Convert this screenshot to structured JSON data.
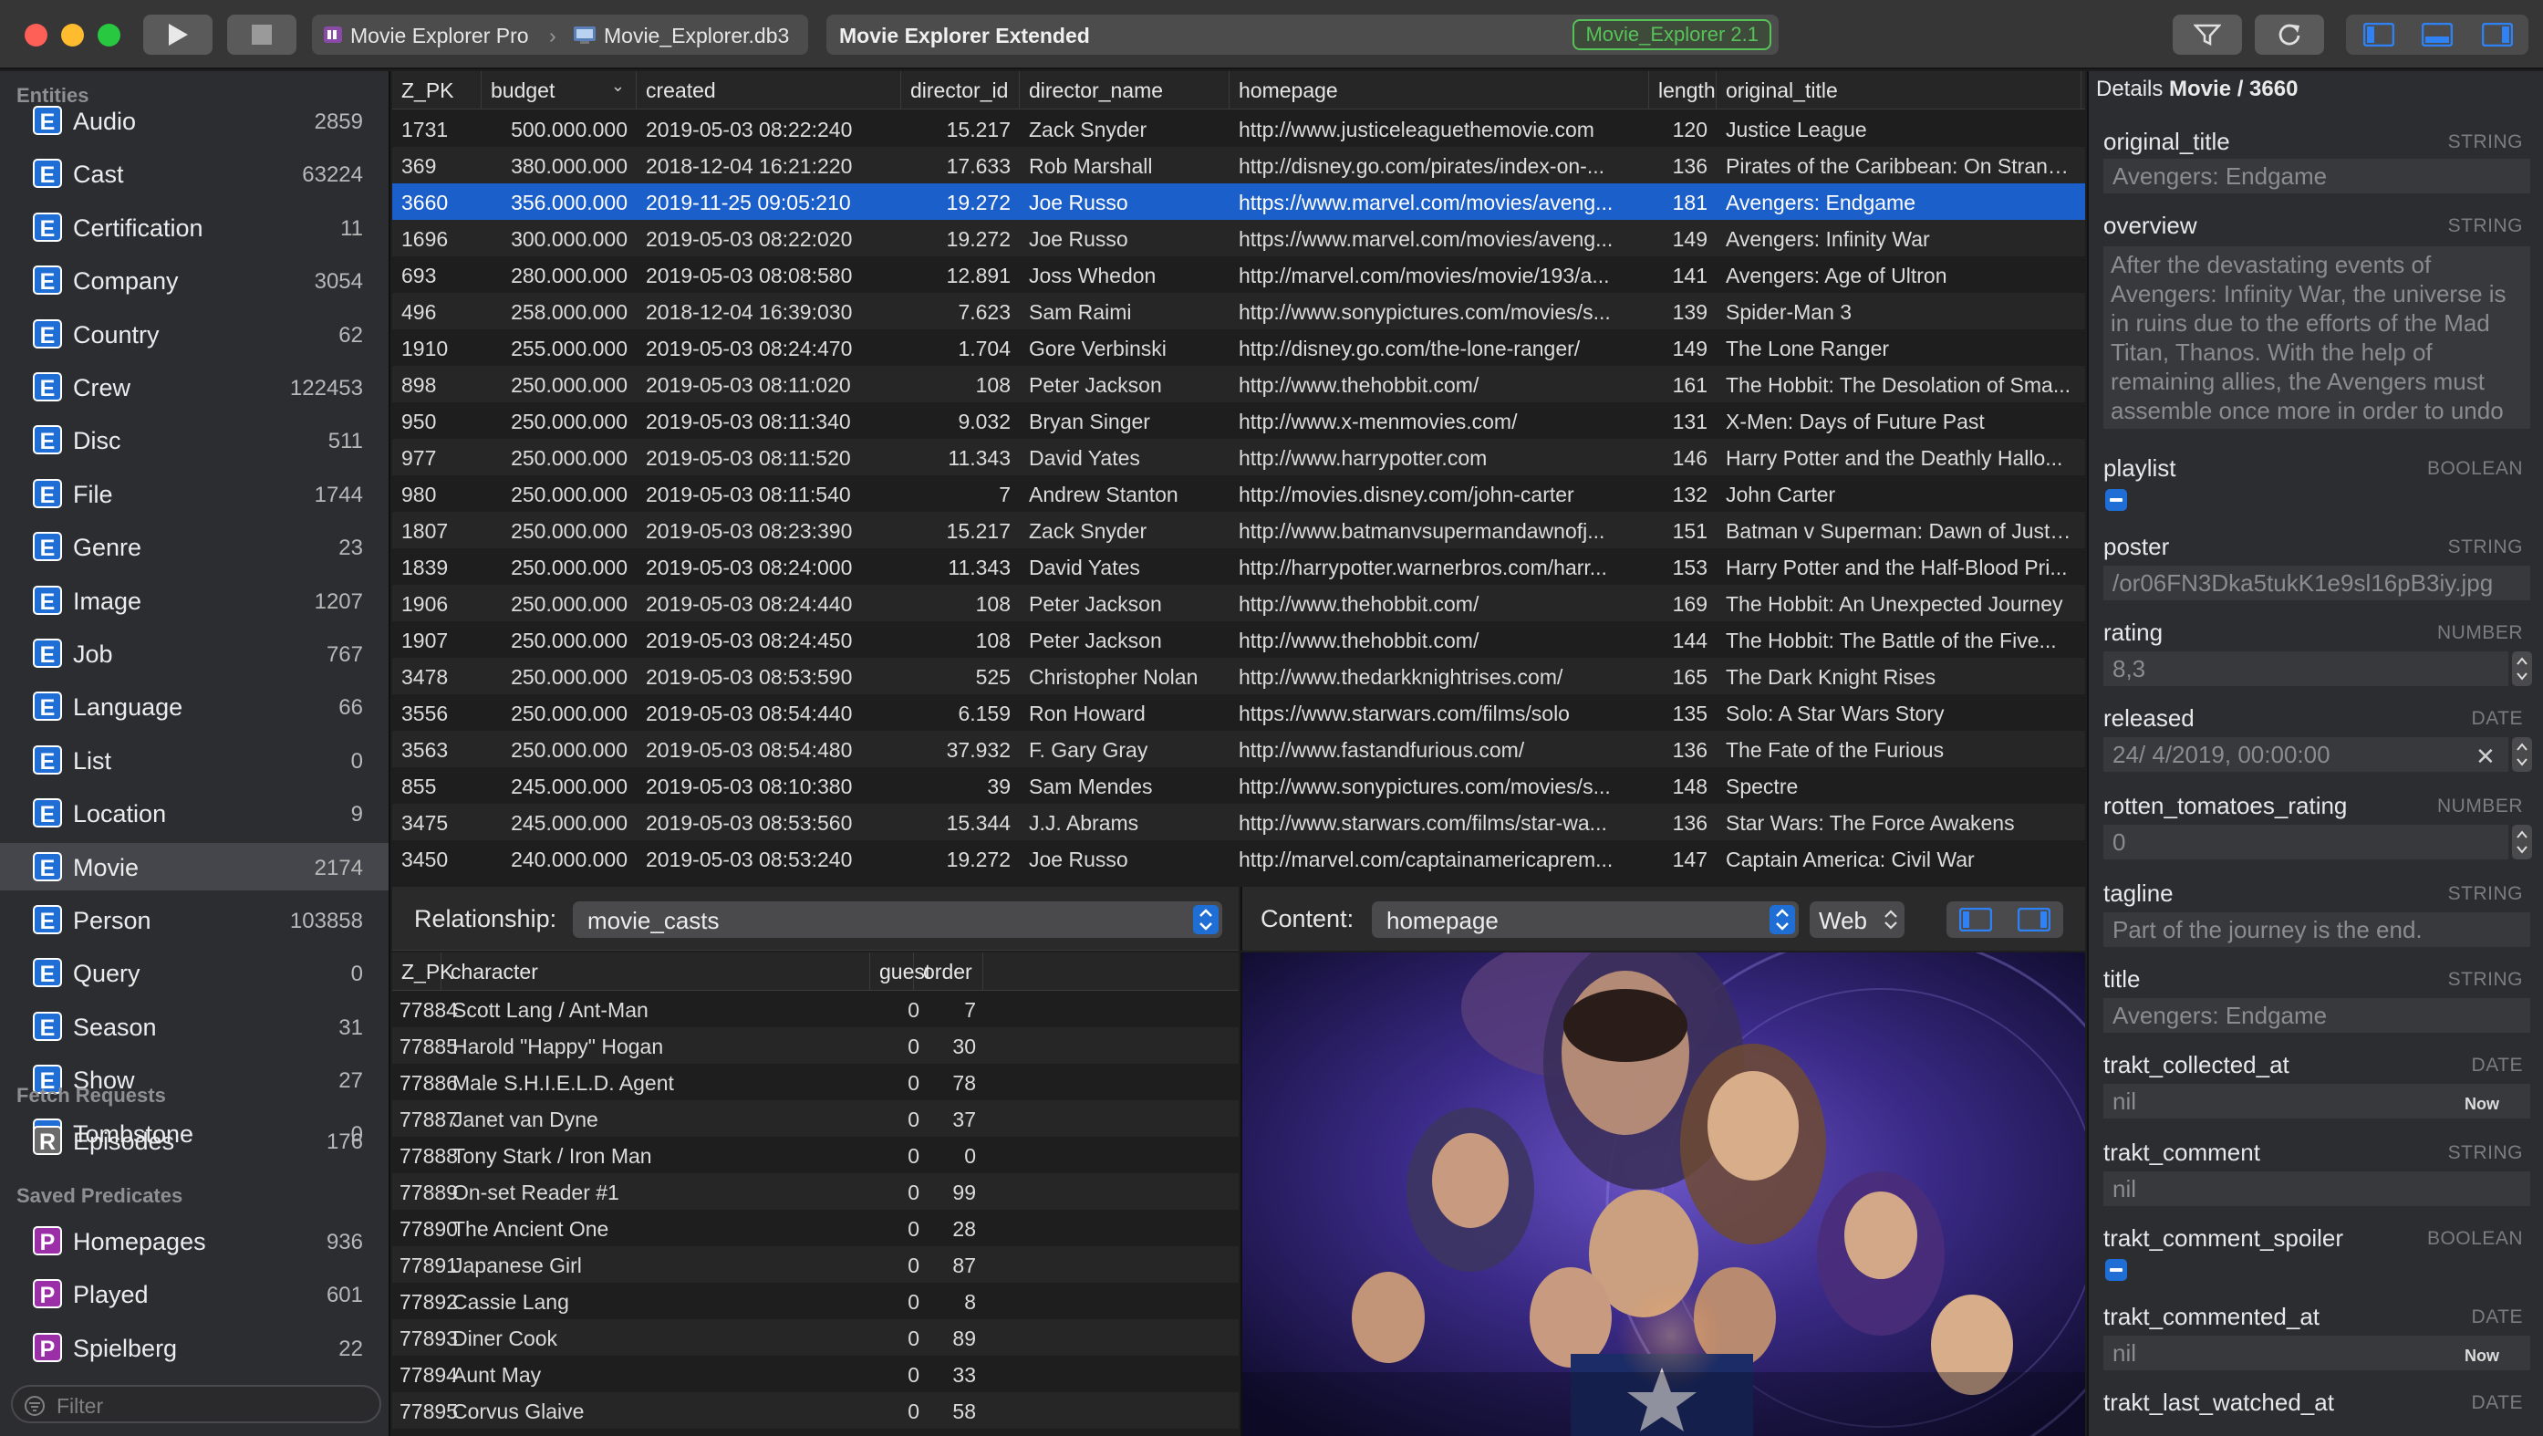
{
  "window": {
    "app_name": "Movie Explorer Pro",
    "file_name": "Movie_Explorer.db3",
    "document_title": "Movie Explorer Extended",
    "version_badge": "Movie_Explorer 2.1"
  },
  "sidebar": {
    "entities_header": "Entities",
    "entities": [
      {
        "label": "Audio",
        "count": "2859"
      },
      {
        "label": "Cast",
        "count": "63224"
      },
      {
        "label": "Certification",
        "count": "11"
      },
      {
        "label": "Company",
        "count": "3054"
      },
      {
        "label": "Country",
        "count": "62"
      },
      {
        "label": "Crew",
        "count": "122453"
      },
      {
        "label": "Disc",
        "count": "511"
      },
      {
        "label": "File",
        "count": "1744"
      },
      {
        "label": "Genre",
        "count": "23"
      },
      {
        "label": "Image",
        "count": "1207"
      },
      {
        "label": "Job",
        "count": "767"
      },
      {
        "label": "Language",
        "count": "66"
      },
      {
        "label": "List",
        "count": "0"
      },
      {
        "label": "Location",
        "count": "9"
      },
      {
        "label": "Movie",
        "count": "2174"
      },
      {
        "label": "Person",
        "count": "103858"
      },
      {
        "label": "Query",
        "count": "0"
      },
      {
        "label": "Season",
        "count": "31"
      },
      {
        "label": "Show",
        "count": "27"
      },
      {
        "label": "Tombstone",
        "count": "0"
      }
    ],
    "entity_badge": "E",
    "fetch_header": "Fetch Requests",
    "fetch_requests": [
      {
        "label": "Episodes",
        "count": "176"
      }
    ],
    "fetch_badge": "R",
    "predicates_header": "Saved Predicates",
    "predicates": [
      {
        "label": "Homepages",
        "count": "936"
      },
      {
        "label": "Played",
        "count": "601"
      },
      {
        "label": "Spielberg",
        "count": "22"
      }
    ],
    "predicate_badge": "P",
    "filter_placeholder": "Filter"
  },
  "grid": {
    "columns": [
      "Z_PK",
      "budget",
      "created",
      "director_id",
      "director_name",
      "homepage",
      "length",
      "original_title"
    ],
    "rows": [
      [
        "1731",
        "500.000.000",
        "2019-05-03 08:22:240",
        "15.217",
        "Zack Snyder",
        "http://www.justiceleaguethemovie.com",
        "120",
        "Justice League"
      ],
      [
        "369",
        "380.000.000",
        "2018-12-04 16:21:220",
        "17.633",
        "Rob Marshall",
        "http://disney.go.com/pirates/index-on-...",
        "136",
        "Pirates of the Caribbean: On Strang..."
      ],
      [
        "3660",
        "356.000.000",
        "2019-11-25 09:05:210",
        "19.272",
        "Joe Russo",
        "https://www.marvel.com/movies/aveng...",
        "181",
        "Avengers: Endgame"
      ],
      [
        "1696",
        "300.000.000",
        "2019-05-03 08:22:020",
        "19.272",
        "Joe Russo",
        "https://www.marvel.com/movies/aveng...",
        "149",
        "Avengers: Infinity War"
      ],
      [
        "693",
        "280.000.000",
        "2019-05-03 08:08:580",
        "12.891",
        "Joss Whedon",
        "http://marvel.com/movies/movie/193/a...",
        "141",
        "Avengers: Age of Ultron"
      ],
      [
        "496",
        "258.000.000",
        "2018-12-04 16:39:030",
        "7.623",
        "Sam Raimi",
        "http://www.sonypictures.com/movies/s...",
        "139",
        "Spider-Man 3"
      ],
      [
        "1910",
        "255.000.000",
        "2019-05-03 08:24:470",
        "1.704",
        "Gore Verbinski",
        "http://disney.go.com/the-lone-ranger/",
        "149",
        "The Lone Ranger"
      ],
      [
        "898",
        "250.000.000",
        "2019-05-03 08:11:020",
        "108",
        "Peter Jackson",
        "http://www.thehobbit.com/",
        "161",
        "The Hobbit: The Desolation of Sma..."
      ],
      [
        "950",
        "250.000.000",
        "2019-05-03 08:11:340",
        "9.032",
        "Bryan Singer",
        "http://www.x-menmovies.com/",
        "131",
        "X-Men: Days of Future Past"
      ],
      [
        "977",
        "250.000.000",
        "2019-05-03 08:11:520",
        "11.343",
        "David Yates",
        "http://www.harrypotter.com",
        "146",
        "Harry Potter and the Deathly Hallo..."
      ],
      [
        "980",
        "250.000.000",
        "2019-05-03 08:11:540",
        "7",
        "Andrew Stanton",
        "http://movies.disney.com/john-carter",
        "132",
        "John Carter"
      ],
      [
        "1807",
        "250.000.000",
        "2019-05-03 08:23:390",
        "15.217",
        "Zack Snyder",
        "http://www.batmanvsupermandawnofj...",
        "151",
        "Batman v Superman: Dawn of Justice"
      ],
      [
        "1839",
        "250.000.000",
        "2019-05-03 08:24:000",
        "11.343",
        "David Yates",
        "http://harrypotter.warnerbros.com/harr...",
        "153",
        "Harry Potter and the Half-Blood Pri..."
      ],
      [
        "1906",
        "250.000.000",
        "2019-05-03 08:24:440",
        "108",
        "Peter Jackson",
        "http://www.thehobbit.com/",
        "169",
        "The Hobbit: An Unexpected Journey"
      ],
      [
        "1907",
        "250.000.000",
        "2019-05-03 08:24:450",
        "108",
        "Peter Jackson",
        "http://www.thehobbit.com/",
        "144",
        "The Hobbit: The Battle of the Five..."
      ],
      [
        "3478",
        "250.000.000",
        "2019-05-03 08:53:590",
        "525",
        "Christopher Nolan",
        "http://www.thedarkknightrises.com/",
        "165",
        "The Dark Knight Rises"
      ],
      [
        "3556",
        "250.000.000",
        "2019-05-03 08:54:440",
        "6.159",
        "Ron Howard",
        "https://www.starwars.com/films/solo",
        "135",
        "Solo: A Star Wars Story"
      ],
      [
        "3563",
        "250.000.000",
        "2019-05-03 08:54:480",
        "37.932",
        "F. Gary Gray",
        "http://www.fastandfurious.com/",
        "136",
        "The Fate of the Furious"
      ],
      [
        "855",
        "245.000.000",
        "2019-05-03 08:10:380",
        "39",
        "Sam Mendes",
        "http://www.sonypictures.com/movies/s...",
        "148",
        "Spectre"
      ],
      [
        "3475",
        "245.000.000",
        "2019-05-03 08:53:560",
        "15.344",
        "J.J. Abrams",
        "http://www.starwars.com/films/star-wa...",
        "136",
        "Star Wars: The Force Awakens"
      ],
      [
        "3450",
        "240.000.000",
        "2019-05-03 08:53:240",
        "19.272",
        "Joe Russo",
        "http://marvel.com/captainamericaprem...",
        "147",
        "Captain America: Civil War"
      ]
    ]
  },
  "relationship": {
    "label": "Relationship:",
    "value": "movie_casts",
    "columns": [
      "Z_PK",
      "character",
      "guest",
      "order"
    ],
    "rows": [
      [
        "77884",
        "Scott Lang / Ant-Man",
        "0",
        "7"
      ],
      [
        "77885",
        "Harold \"Happy\" Hogan",
        "0",
        "30"
      ],
      [
        "77886",
        "Male S.H.I.E.L.D. Agent",
        "0",
        "78"
      ],
      [
        "77887",
        "Janet van Dyne",
        "0",
        "37"
      ],
      [
        "77888",
        "Tony Stark / Iron Man",
        "0",
        "0"
      ],
      [
        "77889",
        "On-set Reader #1",
        "0",
        "99"
      ],
      [
        "77890",
        "The Ancient One",
        "0",
        "28"
      ],
      [
        "77891",
        "Japanese Girl",
        "0",
        "87"
      ],
      [
        "77892",
        "Cassie Lang",
        "0",
        "8"
      ],
      [
        "77893",
        "Diner Cook",
        "0",
        "89"
      ],
      [
        "77894",
        "Aunt May",
        "0",
        "33"
      ],
      [
        "77895",
        "Corvus Glaive",
        "0",
        "58"
      ]
    ]
  },
  "content": {
    "label": "Content:",
    "value": "homepage",
    "mode": "Web"
  },
  "details": {
    "entity": "Details",
    "title": "Movie / 3660",
    "fields": {
      "original_title": {
        "name": "original_title",
        "type": "STRING",
        "value": "Avengers: Endgame"
      },
      "overview": {
        "name": "overview",
        "type": "STRING",
        "value": "After the devastating events of Avengers: Infinity War, the universe is in ruins due to the efforts of the Mad Titan, Thanos. With the help of remaining allies, the Avengers must assemble once more in order to undo"
      },
      "playlist": {
        "name": "playlist",
        "type": "BOOLEAN"
      },
      "poster": {
        "name": "poster",
        "type": "STRING",
        "value": "/or06FN3Dka5tukK1e9sl16pB3iy.jpg"
      },
      "rating": {
        "name": "rating",
        "type": "NUMBER",
        "value": "8,3"
      },
      "released": {
        "name": "released",
        "type": "DATE",
        "value": "24/  4/2019, 00:00:00"
      },
      "rotten_tomatoes_rating": {
        "name": "rotten_tomatoes_rating",
        "type": "NUMBER",
        "value": "0"
      },
      "tagline": {
        "name": "tagline",
        "type": "STRING",
        "value": "Part of the journey is the end."
      },
      "title": {
        "name": "title",
        "type": "STRING",
        "value": "Avengers: Endgame"
      },
      "trakt_collected_at": {
        "name": "trakt_collected_at",
        "type": "DATE",
        "value": "nil",
        "now": "Now"
      },
      "trakt_comment": {
        "name": "trakt_comment",
        "type": "STRING",
        "value": "nil"
      },
      "trakt_comment_spoiler": {
        "name": "trakt_comment_spoiler",
        "type": "BOOLEAN"
      },
      "trakt_commented_at": {
        "name": "trakt_commented_at",
        "type": "DATE",
        "value": "nil",
        "now": "Now"
      },
      "trakt_last_watched_at": {
        "name": "trakt_last_watched_at",
        "type": "DATE"
      }
    }
  },
  "colors": {
    "selection": "#1b5fcb",
    "accent": "#1f6ed6",
    "badge_green": "#58c25a"
  }
}
